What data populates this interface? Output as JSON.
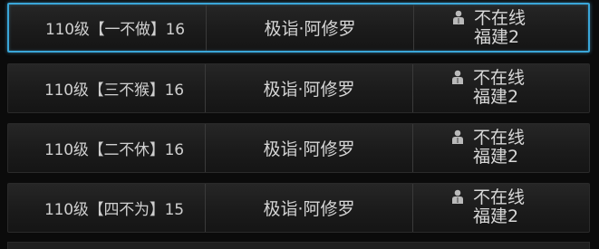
{
  "members": [
    {
      "name": "110级【一不做】16",
      "class": "极诣·阿修罗",
      "status": "不在线",
      "server": "福建2",
      "selected": true
    },
    {
      "name": "110级【三不猴】16",
      "class": "极诣·阿修罗",
      "status": "不在线",
      "server": "福建2",
      "selected": false
    },
    {
      "name": "110级【二不休】16",
      "class": "极诣·阿修罗",
      "status": "不在线",
      "server": "福建2",
      "selected": false
    },
    {
      "name": "110级【四不为】15",
      "class": "极诣·阿修罗",
      "status": "不在线",
      "server": "福建2",
      "selected": false
    }
  ],
  "icons": {
    "status": "person-icon"
  },
  "colors": {
    "selection_border": "#3aa6d8",
    "row_bg": "#1b1b1b",
    "text": "#cfcfcf"
  }
}
